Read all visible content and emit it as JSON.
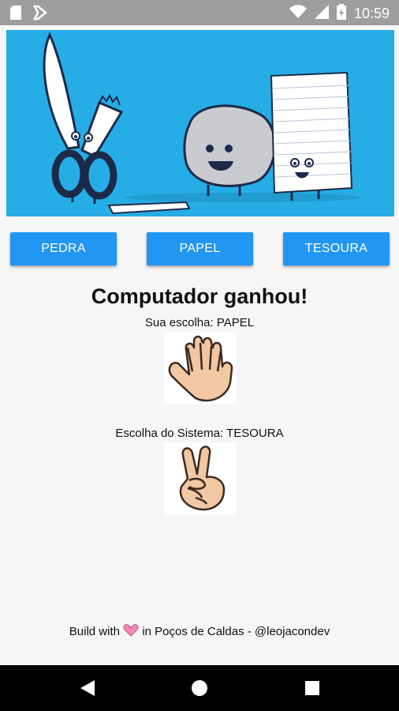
{
  "status_bar": {
    "time": "10:59",
    "icons": [
      "sd-card-icon",
      "notification-icon",
      "wifi-icon",
      "signal-icon",
      "battery-icon"
    ]
  },
  "hero_image": {
    "description_icon": "scissors-rock-paper-illustration"
  },
  "buttons": {
    "pedra": "PEDRA",
    "papel": "PAPEL",
    "tesoura": "TESOURA"
  },
  "result": {
    "title": "Computador ganhou!",
    "user_choice_label": "Sua escolha: PAPEL",
    "system_choice_label": "Escolha do Sistema: TESOURA"
  },
  "footer": {
    "prefix": "Build with",
    "suffix": "in Poços de Caldas - @leojacondev"
  },
  "colors": {
    "button": "#2196f3",
    "hero_bg": "#27ade5",
    "status_bar": "#9e9e9e"
  }
}
